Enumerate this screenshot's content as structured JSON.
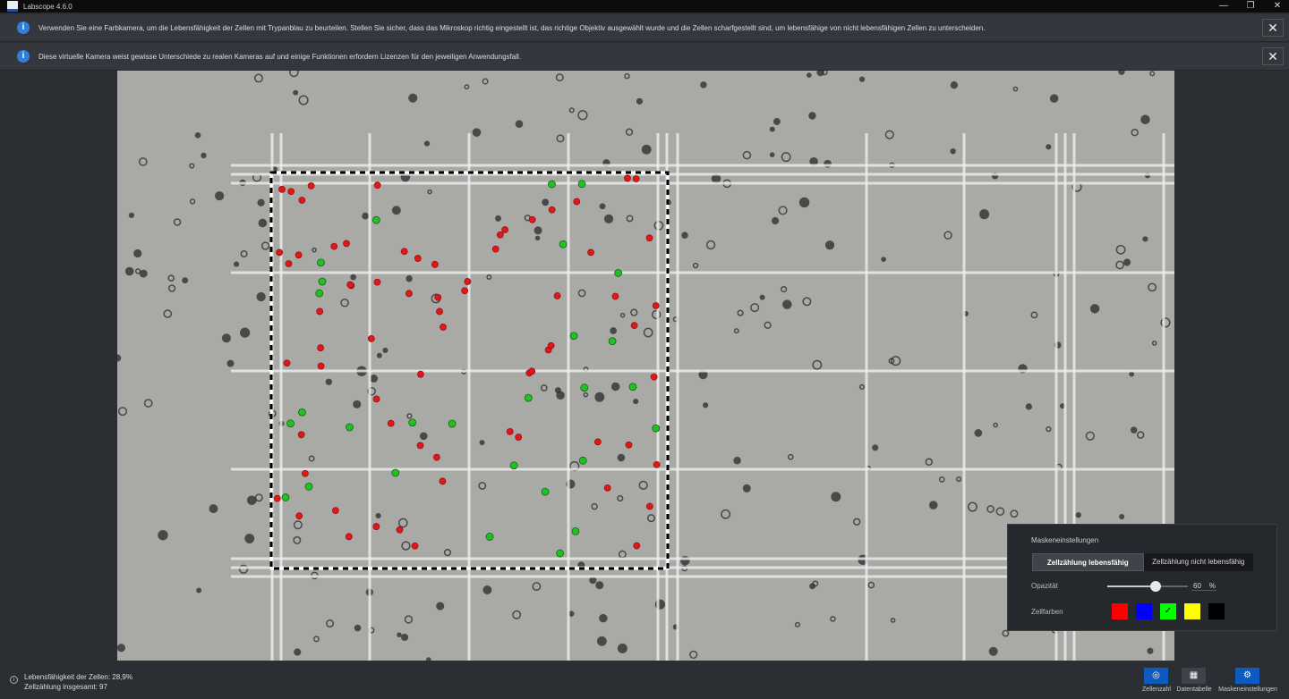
{
  "window": {
    "title": "Labscope 4.6.0",
    "minimize": "—",
    "restore": "❐",
    "close": "✕"
  },
  "banners": [
    {
      "icon": "info-icon",
      "text": "Verwenden Sie eine Farbkamera, um die Lebensfähigkeit der Zellen mit Trypanblau zu beurteilen. Stellen Sie sicher, dass das Mikroskop richtig eingestellt ist, das richtige Objektiv ausgewählt wurde und die Zellen scharfgestellt sind, um lebensfähige von nicht lebensfähigen Zellen zu unterscheiden.",
      "close": "✕"
    },
    {
      "icon": "info-icon",
      "text": "Diese virtuelle Kamera weist gewisse Unterschiede zu realen Kameras auf und einige Funktionen erfordern Lizenzen für den jeweiligen Anwendungsfall.",
      "close": "✕"
    }
  ],
  "mask_panel": {
    "title": "Maskeneinstellungen",
    "tabs": [
      {
        "label": "Zellzählung lebensfähig",
        "active": true
      },
      {
        "label": "Zellzählung nicht lebensfähig",
        "active": false
      }
    ],
    "opacity_label": "Opazität",
    "opacity_value": "60",
    "opacity_unit": "%",
    "colors_label": "Zellfarben",
    "colors": [
      "#ff0000",
      "#0000ff",
      "#00ff00",
      "#ffff00",
      "#000000"
    ],
    "selected_color": "#00ff00",
    "check": "✓"
  },
  "status": {
    "viability": "Lebensfähigkeit der Zellen: 28,9%",
    "total": "Zellzählung insgesamt: 97"
  },
  "toolbar": {
    "cell_count": "Zellenzahl",
    "data_table": "Datentabelle",
    "mask_settings": "Maskeneinstellungen"
  },
  "cells": {
    "total": 97,
    "viable": 28,
    "viable_color": "#22c022",
    "dead_color": "#e01818"
  }
}
